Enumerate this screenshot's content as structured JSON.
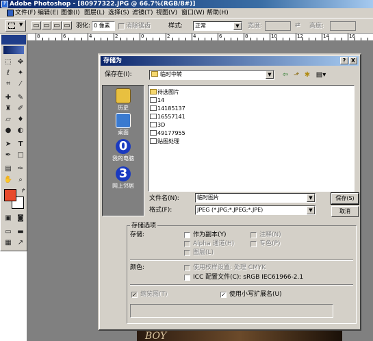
{
  "app": {
    "title": "Adobe Photoshop - [80977322.JPG @ 66.7%(RGB/8#)]"
  },
  "menu": [
    "文件(F)",
    "编辑(E)",
    "图像(I)",
    "图层(L)",
    "选择(S)",
    "滤镜(T)",
    "视图(V)",
    "窗口(W)",
    "帮助(H)"
  ],
  "options": {
    "feather_label": "羽化:",
    "feather_value": "0 像素",
    "antialias_label": "消除锯齿",
    "style_label": "样式:",
    "style_value": "正常",
    "width_label": "宽度:",
    "height_label": "高度:"
  },
  "ruler": [
    "8",
    "6",
    "4",
    "2",
    "0",
    "2",
    "4",
    "6",
    "8",
    "10",
    "12",
    "14",
    "16"
  ],
  "dialog": {
    "title": "存储为",
    "help_btn": "?",
    "close_btn": "X",
    "save_in_label": "保存在(I):",
    "save_in_value": "临时中转",
    "places": [
      {
        "label": "历史",
        "icon": "history-icon"
      },
      {
        "label": "桌面",
        "icon": "desktop-icon"
      },
      {
        "label": "我的电脑",
        "icon": "my-computer-icon"
      },
      {
        "label": "网上邻居",
        "icon": "network-places-icon"
      }
    ],
    "files": [
      {
        "name": "待选图片",
        "type": "folder"
      },
      {
        "name": "14",
        "type": "jpg"
      },
      {
        "name": "14185137",
        "type": "jpg"
      },
      {
        "name": "16557141",
        "type": "jpg"
      },
      {
        "name": "3D",
        "type": "jpg"
      },
      {
        "name": "49177955",
        "type": "jpg"
      },
      {
        "name": "贴图处理",
        "type": "jpg"
      }
    ],
    "filename_label": "文件名(N):",
    "filename_value": "临时图片",
    "format_label": "格式(F):",
    "format_value": "JPEG (*.JPG;*.JPEG;*.JPE)",
    "save_btn": "保存(S)",
    "cancel_btn": "取消",
    "options_group": "存储选项",
    "storage_label": "存储:",
    "as_copy": "作为副本(Y)",
    "annotations": "注释(N)",
    "alpha": "Alpha 通道(H)",
    "spot": "专色(P)",
    "layers": "图层(L)",
    "color_label": "颜色:",
    "proof": "使用校样设置: 处理 CMYK",
    "icc": "ICC 配置文件(C): sRGB IEC61966-2.1",
    "thumbnail": "缩览图(T)",
    "lowercase": "使用小写扩展名(U)"
  },
  "photo_text": "BOY",
  "colors": {
    "foreground": "#e84a2c",
    "background": "#ffffff",
    "title_start": "#0a246a",
    "title_end": "#a6caf0"
  }
}
